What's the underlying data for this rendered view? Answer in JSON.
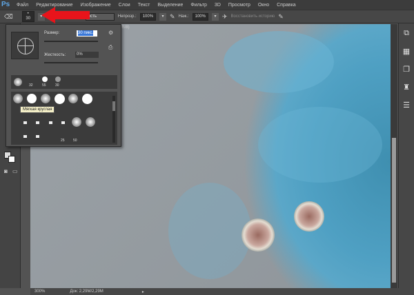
{
  "app": {
    "logo": "Ps"
  },
  "menu": [
    "Файл",
    "Редактирование",
    "Изображение",
    "Слои",
    "Текст",
    "Выделение",
    "Фильтр",
    "3D",
    "Просмотр",
    "Окно",
    "Справка"
  ],
  "options": {
    "brush_size": "30",
    "mode_label": "ость",
    "opacity_label": "Непрозр.:",
    "opacity": "100%",
    "flow_label": "Наж.:",
    "flow": "100%",
    "restore_history": "Восстановить историю"
  },
  "document": {
    "tab_suffix": "GB/8)"
  },
  "brush_panel": {
    "size_label": "Размер:",
    "size_value": "30 пикс.",
    "hardness_label": "Жесткость:",
    "hardness_value": "0%",
    "recent_sizes": [
      "32",
      "55",
      "30"
    ],
    "bottom_sizes": [
      "25",
      "50"
    ],
    "tooltip": "Мягкая круглая"
  },
  "status": {
    "zoom": "300%",
    "doc_size": "Док: 2,29M/2,29M"
  },
  "colors": {
    "accent": "#e8141b"
  }
}
